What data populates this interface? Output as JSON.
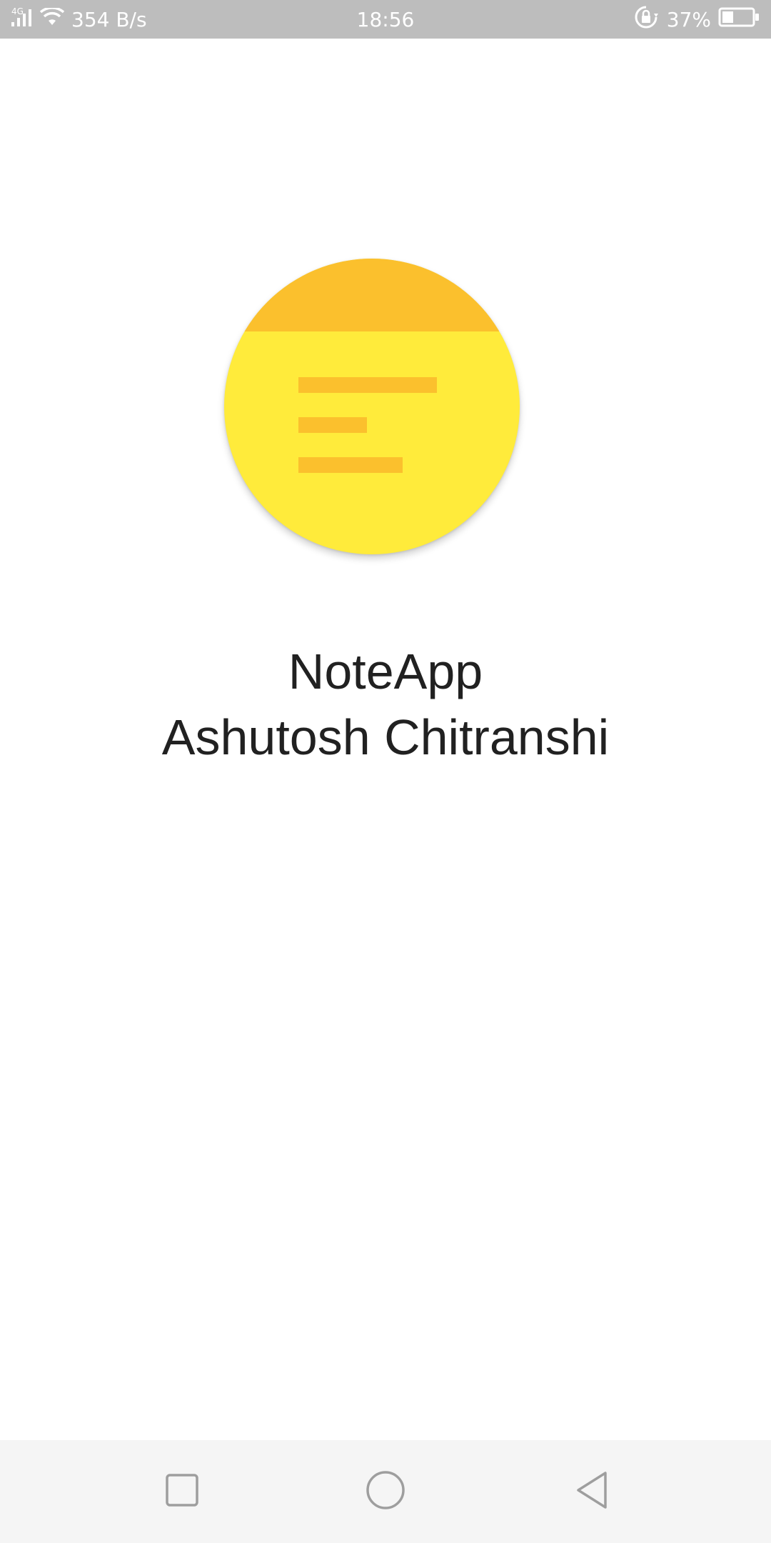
{
  "status_bar": {
    "network_label": "4G",
    "speed": "354 B/s",
    "time": "18:56",
    "battery_percent": "37%",
    "battery_level": 0.37,
    "icons": [
      "signal-icon",
      "wifi-icon",
      "rotation-lock-icon",
      "battery-icon"
    ],
    "colors": {
      "background": "#bdbdbd",
      "foreground": "#ffffff"
    }
  },
  "splash": {
    "logo_icon": "note-icon",
    "app_name": "NoteApp",
    "author": "Ashutosh Chitranshi",
    "colors": {
      "logo_body": "#ffeb3b",
      "logo_accent": "#fbc02d",
      "text": "#212121"
    }
  },
  "nav_bar": {
    "icons": [
      "recent-apps-icon",
      "home-icon",
      "back-icon"
    ],
    "colors": {
      "background": "#f5f5f5",
      "icon": "#9e9e9e"
    }
  }
}
